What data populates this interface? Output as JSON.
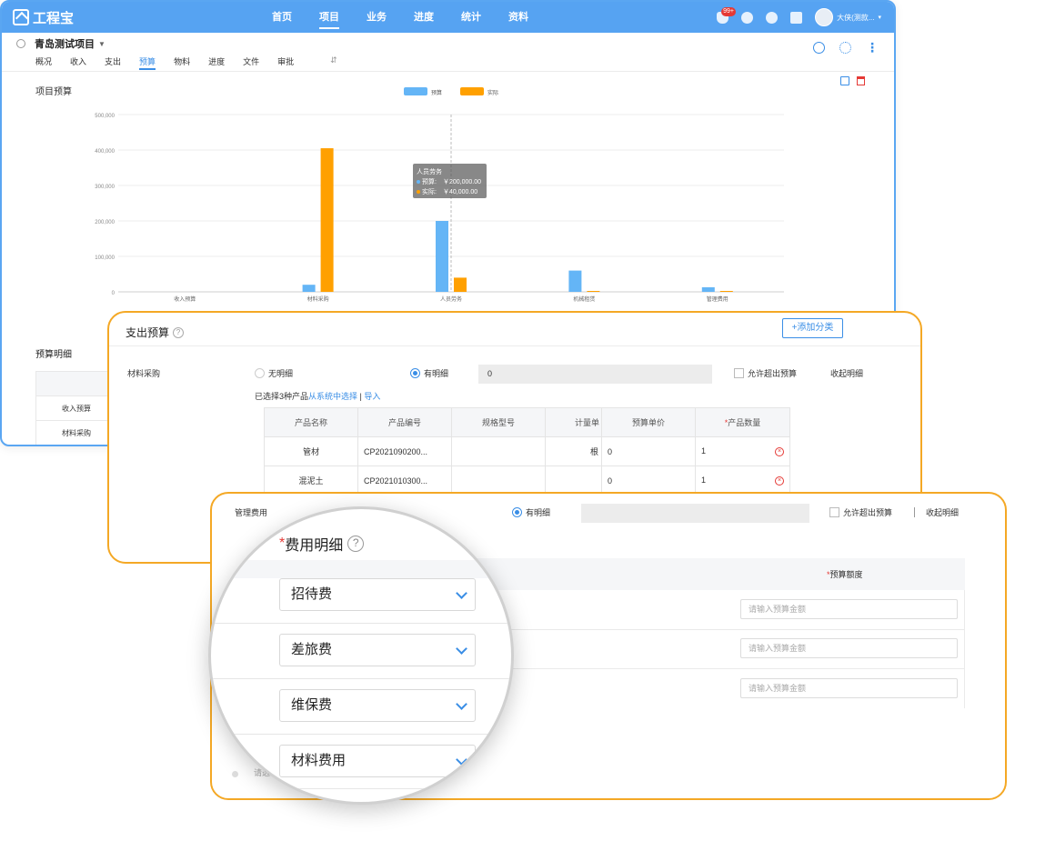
{
  "app": {
    "logo_text": "工程宝",
    "nav": [
      "首页",
      "项目",
      "业务",
      "进度",
      "统计",
      "资料"
    ],
    "active_nav": 1,
    "notification_count": "99+",
    "user_name": "大侠(测款..."
  },
  "project": {
    "title": "青岛测试项目",
    "tabs": [
      "概况",
      "收入",
      "支出",
      "预算",
      "物料",
      "进度",
      "文件",
      "审批"
    ],
    "active_tab": 3
  },
  "chart_data": {
    "type": "bar",
    "title": "项目预算",
    "categories": [
      "收入预算",
      "材料采购",
      "人员劳务",
      "机械租赁",
      "管理费用"
    ],
    "series": [
      {
        "name": "预算",
        "color": "#64b5f6",
        "values": [
          0,
          20000,
          200000,
          60000,
          13000
        ]
      },
      {
        "name": "实际",
        "color": "#ffa000",
        "values": [
          0,
          405000,
          40000,
          2000,
          2000
        ]
      }
    ],
    "y_ticks": [
      "0",
      "100,000",
      "200,000",
      "300,000",
      "400,000",
      "500,000"
    ],
    "ylim": [
      0,
      500000
    ],
    "legend_position": "top-center",
    "grid": true,
    "tooltip": {
      "category": "人员劳务",
      "lines": [
        {
          "label": "预算:",
          "value": "￥200,000.00"
        },
        {
          "label": "实际:",
          "value": "￥40,000.00"
        }
      ]
    }
  },
  "budget_detail": {
    "label": "预算明细",
    "rows": [
      "收入预算",
      "材料采购"
    ]
  },
  "expense": {
    "title": "支出预算",
    "add_category": "+添加分类",
    "material_label": "材料采购",
    "no_detail": "无明细",
    "has_detail": "有明细",
    "amount": "0",
    "allow_exceed": "允许超出预算",
    "collapse": "收起明细",
    "selected_prefix": "已选择3种产品",
    "select_link": "从系统中选择",
    "sep": "|",
    "import_link": "导入",
    "columns": [
      "产品名称",
      "产品编号",
      "规格型号",
      "计量单",
      "预算单价",
      "产品数量"
    ],
    "rows": [
      {
        "name": "管材",
        "code": "CP2021090200...",
        "spec": "",
        "unit": "根",
        "price": "0",
        "qty": "1"
      },
      {
        "name": "混泥土",
        "code": "CP2021010300...",
        "spec": "",
        "unit": "",
        "price": "0",
        "qty": "1"
      }
    ]
  },
  "management": {
    "label": "管理费用",
    "has_detail": "有明细",
    "allow_exceed": "允许超出预算",
    "collapse": "收起明细",
    "amount_header": "预算额度",
    "input_placeholder": "请输入预算金额",
    "bottom_hint": "请选"
  },
  "zoom": {
    "title": "费用明细",
    "options": [
      "招待费",
      "差旅费",
      "维保费",
      "材料费用"
    ]
  },
  "colors": {
    "primary": "#56a3f2",
    "accent": "#f4a825",
    "danger": "#e53935"
  }
}
